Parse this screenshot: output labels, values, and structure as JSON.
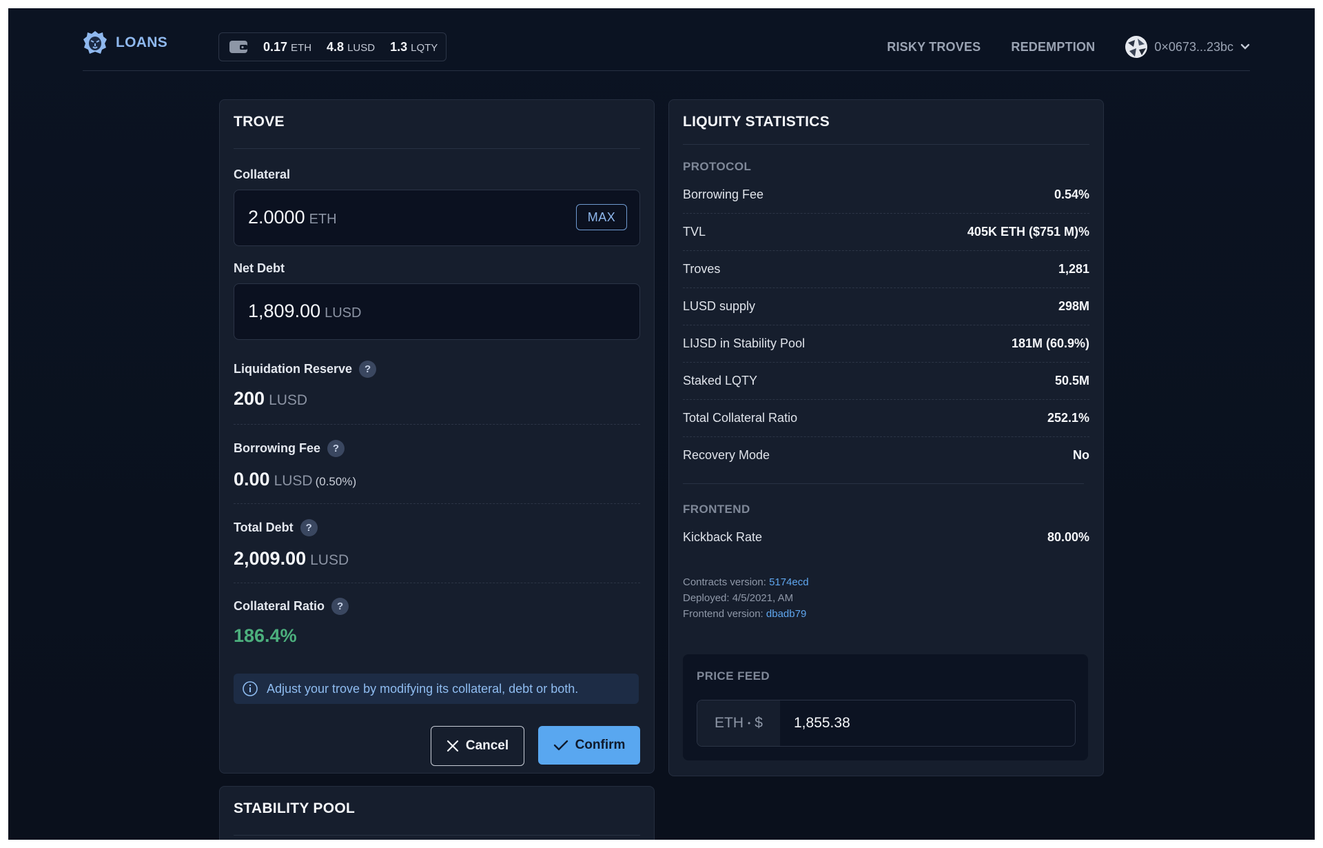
{
  "header": {
    "logo_label": "LOANS",
    "balances": [
      {
        "value": "0.17",
        "unit": "ETH"
      },
      {
        "value": "4.8",
        "unit": "LUSD"
      },
      {
        "value": "1.3",
        "unit": "LQTY"
      }
    ],
    "nav": [
      "RISKY TROVES",
      "REDEMPTION"
    ],
    "account": "0×0673...23bc"
  },
  "trove": {
    "title": "TROVE",
    "collateral_label": "Collateral",
    "collateral_value": "2.0000",
    "collateral_unit": "ETH",
    "max_label": "MAX",
    "net_debt_label": "Net Debt",
    "net_debt_value": "1,809.00",
    "net_debt_unit": "LUSD",
    "liq_reserve_label": "Liquidation Reserve",
    "liq_reserve_value": "200",
    "liq_reserve_unit": "LUSD",
    "borrowing_fee_label": "Borrowing Fee",
    "borrowing_fee_value": "0.00",
    "borrowing_fee_unit": "LUSD",
    "borrowing_fee_pct": "(0.50%)",
    "total_debt_label": "Total Debt",
    "total_debt_value": "2,009.00",
    "total_debt_unit": "LUSD",
    "coll_ratio_label": "Collateral Ratio",
    "coll_ratio_value": "186.4%",
    "info_text": "Adjust your trove by modifying its collateral, debt or both.",
    "cancel_label": "Cancel",
    "confirm_label": "Confirm",
    "help_glyph": "?"
  },
  "stability": {
    "title": "STABILITY POOL"
  },
  "stats": {
    "title": "LIQUITY STATISTICS",
    "protocol_label": "PROTOCOL",
    "rows": [
      {
        "k": "Borrowing Fee",
        "v": "0.54%"
      },
      {
        "k": "TVL",
        "v": "405K ETH ($751 M)%"
      },
      {
        "k": "Troves",
        "v": "1,281"
      },
      {
        "k": "LUSD supply",
        "v": "298M"
      },
      {
        "k": "LIJSD in Stability Pool",
        "v": "181M (60.9%)"
      },
      {
        "k": "Staked LQTY",
        "v": "50.5M"
      },
      {
        "k": "Total Collateral Ratio",
        "v": "252.1%"
      },
      {
        "k": "Recovery Mode",
        "v": "No"
      }
    ],
    "frontend_label": "FRONTEND",
    "kickback_label": "Kickback Rate",
    "kickback_value": "80.00%",
    "contracts_label": "Contracts version:",
    "contracts_value": "5174ecd",
    "deployed": "Deployed: 4/5/2021, AM",
    "frontend_version_label": "Frontend version:",
    "frontend_version_value": "dbadb79",
    "price_feed_label": "PRICE FEED",
    "price_pair_base": "ETH",
    "price_pair_sep": "•",
    "price_pair_quote": "$",
    "price_value": "1,855.38"
  },
  "colors": {
    "accent": "#59a7f0",
    "ratio_green": "#4caf7d",
    "bg": "#0b1322"
  }
}
